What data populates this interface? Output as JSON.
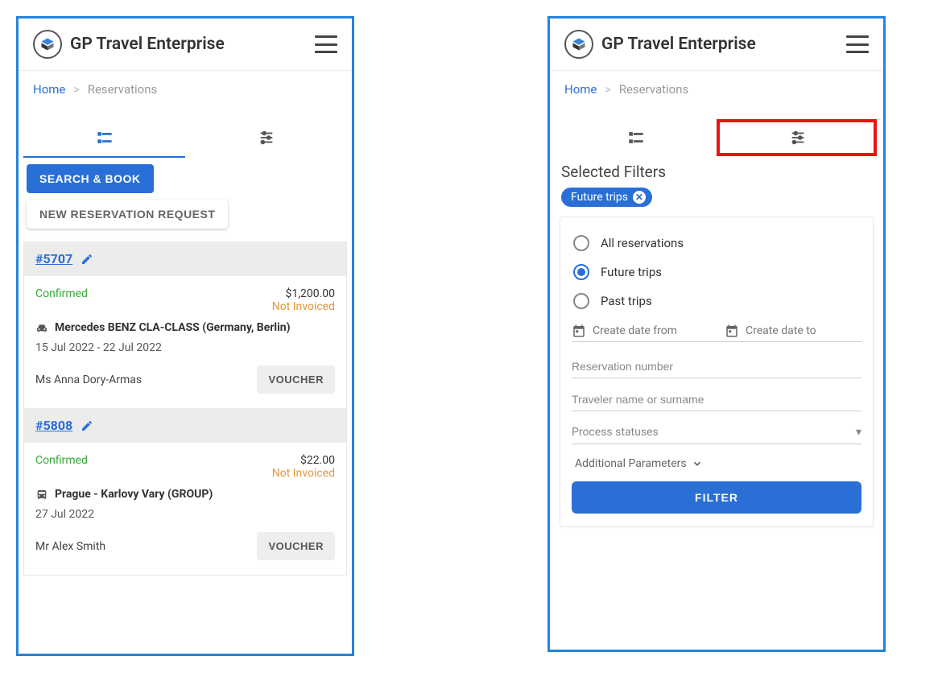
{
  "brand": "GP Travel Enterprise",
  "crumbs": {
    "home": "Home",
    "sep": ">",
    "current": "Reservations"
  },
  "list": {
    "search_book": "SEARCH & BOOK",
    "new_request": "NEW RESERVATION REQUEST",
    "orders": [
      {
        "ref": "#5707",
        "status": "Confirmed",
        "amount": "$1,200.00",
        "invoice": "Not Invoiced",
        "icon": "car",
        "title": "Mercedes BENZ CLA-CLASS (Germany, Berlin)",
        "dates": "15 Jul 2022 - 22 Jul 2022",
        "traveler": "Ms Anna Dory-Armas",
        "voucher": "VOUCHER"
      },
      {
        "ref": "#5808",
        "status": "Confirmed",
        "amount": "$22.00",
        "invoice": "Not Invoiced",
        "icon": "bus",
        "title": "Prague - Karlovy Vary (GROUP)",
        "dates": "27 Jul 2022",
        "traveler": "Mr Alex Smith",
        "voucher": "VOUCHER"
      }
    ]
  },
  "filters": {
    "selected_label": "Selected Filters",
    "chip": "Future trips",
    "radios": [
      "All reservations",
      "Future trips",
      "Past trips"
    ],
    "selected_radio": 1,
    "date_from": "Create date from",
    "date_to": "Create date to",
    "res_num_ph": "Reservation number",
    "traveler_ph": "Traveler name or surname",
    "process_ph": "Process statuses",
    "addl": "Additional Parameters",
    "filter_btn": "FILTER"
  }
}
